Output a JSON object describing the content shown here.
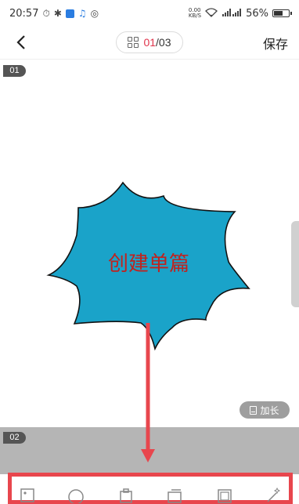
{
  "status_bar": {
    "time": "20:57",
    "net_speed_value": "0.00",
    "net_speed_unit": "KB/S",
    "battery": "56%"
  },
  "header": {
    "page_current": "01",
    "page_total": "/03",
    "save_label": "保存"
  },
  "pages": [
    {
      "label": "01"
    },
    {
      "label": "02"
    }
  ],
  "shape": {
    "text": "创建单篇"
  },
  "lengthen_button": {
    "label": "加长"
  },
  "colors": {
    "accent": "#e0344b",
    "shape_fill": "#1aa3c9",
    "annotation_red": "#e8464d"
  },
  "icons": [
    "back-arrow",
    "grid",
    "lengthen",
    "shape-star"
  ]
}
